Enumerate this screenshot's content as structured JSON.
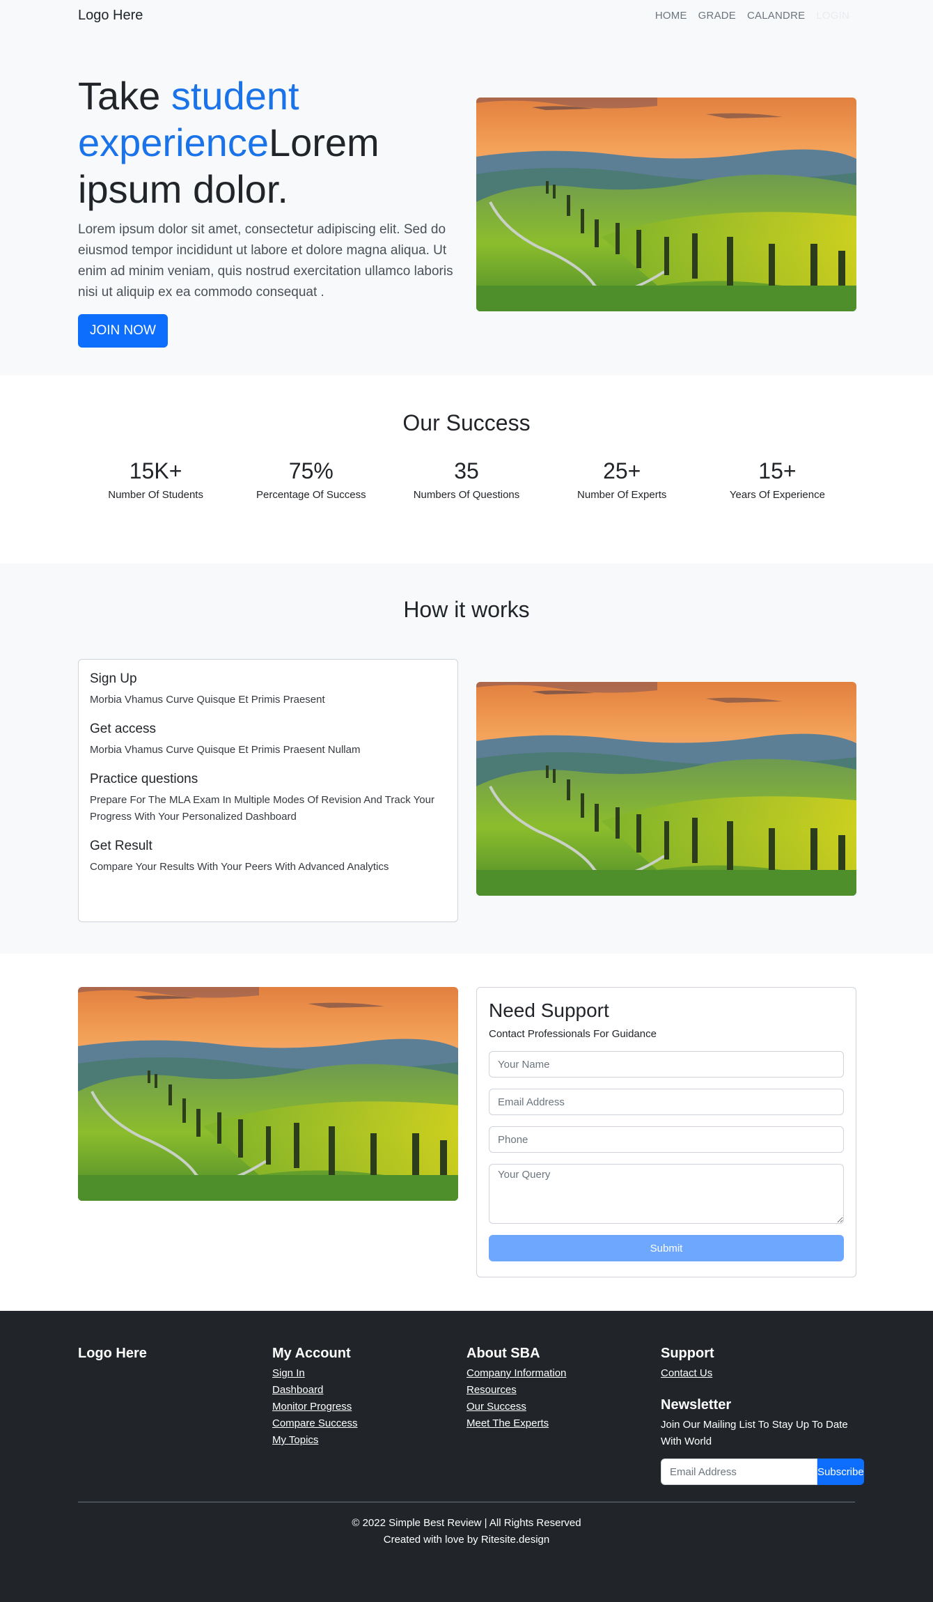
{
  "nav": {
    "brand": "Logo Here",
    "links": [
      "HOME",
      "GRADE",
      "CALANDRE",
      "LOGIN"
    ]
  },
  "hero": {
    "title_pre": "Take ",
    "title_accent": "student experience",
    "title_post": "Lorem ipsum dolor.",
    "lead": "Lorem ipsum dolor sit amet, consectetur adipiscing elit. Sed do eiusmod tempor incididunt ut labore et dolore magna aliqua. Ut enim ad minim veniam, quis nostrud exercitation ullamco laboris nisi ut aliquip ex ea commodo consequat .",
    "cta": "JOIN NOW"
  },
  "success": {
    "title": "Our Success",
    "stats": [
      {
        "value": "15K+",
        "label": "Number Of Students"
      },
      {
        "value": "75%",
        "label": "Percentage Of Success"
      },
      {
        "value": "35",
        "label": "Numbers Of Questions"
      },
      {
        "value": "25+",
        "label": "Number Of Experts"
      },
      {
        "value": "15+",
        "label": "Years Of Experience"
      }
    ]
  },
  "how": {
    "title": "How it works",
    "steps": [
      {
        "title": "Sign Up",
        "desc": "Morbia Vhamus Curve Quisque Et Primis Praesent"
      },
      {
        "title": "Get access",
        "desc": "Morbia Vhamus Curve Quisque Et Primis Praesent Nullam"
      },
      {
        "title": "Practice questions",
        "desc": "Prepare For The MLA Exam In Multiple Modes Of Revision And Track Your Progress With Your Personalized Dashboard"
      },
      {
        "title": "Get Result",
        "desc": "Compare Your Results With Your Peers With Advanced Analytics"
      }
    ]
  },
  "support": {
    "title": "Need Support",
    "subtitle": "Contact Professionals For Guidance",
    "name_placeholder": "Your Name",
    "email_placeholder": "Email Address",
    "phone_placeholder": "Phone",
    "query_placeholder": "Your Query",
    "submit": "Submit"
  },
  "footer": {
    "brand": "Logo Here",
    "account_title": "My Account",
    "account_links": [
      "Sign In",
      "Dashboard",
      "Monitor Progress",
      "Compare Success",
      "My Topics"
    ],
    "about_title": "About SBA",
    "about_links": [
      "Company Information",
      "Resources",
      "Our Success",
      "Meet The Experts"
    ],
    "support_title": "Support",
    "support_links": [
      "Contact Us"
    ],
    "newsletter_title": "Newsletter",
    "newsletter_text": "Join Our Mailing List To Stay Up To Date With World",
    "newsletter_placeholder": "Email Address",
    "subscribe": "Subscribe",
    "copyright": "© 2022 Simple Best Review | All Rights Reserved",
    "credit": "Created with love by Ritesite.design"
  },
  "colors": {
    "primary": "#0d6efd",
    "accent_text": "#1a73e8",
    "light_bg": "#f8f9fa",
    "footer_bg": "#212529",
    "submit_disabled": "#6ea8fe"
  },
  "icons": [
    "landscape-photo"
  ]
}
